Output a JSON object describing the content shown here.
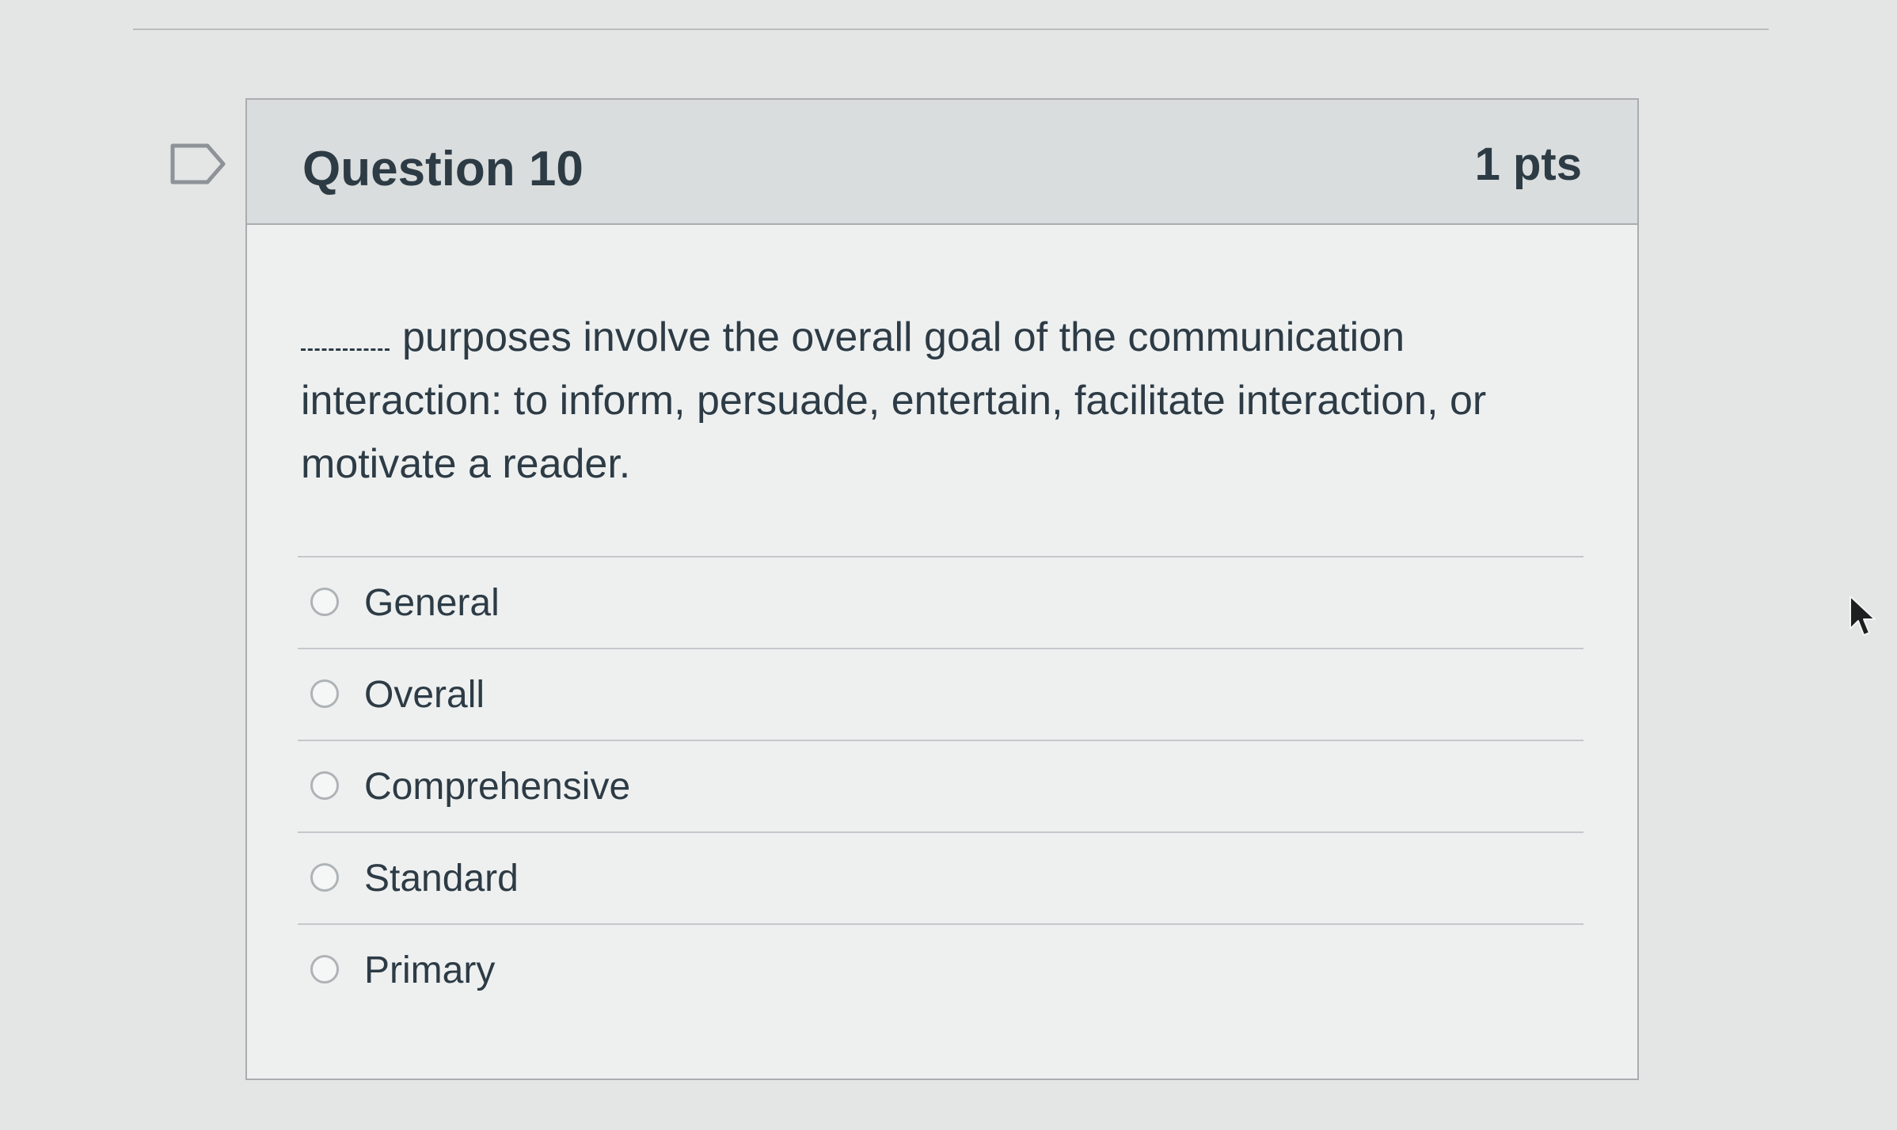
{
  "quiz": {
    "question_title": "Question 10",
    "points": "1 pts",
    "question_text": "purposes involve the overall goal of the communication interaction: to inform, persuade, entertain, facilitate interaction, or motivate a reader.",
    "answers": [
      {
        "label": "General",
        "selected": false
      },
      {
        "label": "Overall",
        "selected": false
      },
      {
        "label": "Comprehensive",
        "selected": false
      },
      {
        "label": "Standard",
        "selected": false
      },
      {
        "label": "Primary",
        "selected": false
      }
    ]
  },
  "icons": {
    "flag": "flag-icon",
    "radio": "radio-button",
    "cursor": "mouse-pointer-icon"
  },
  "colors": {
    "text": "#2d3b45",
    "header_bg": "#dadddd",
    "card_bg": "#eef0f0",
    "border": "#a9adb0"
  }
}
